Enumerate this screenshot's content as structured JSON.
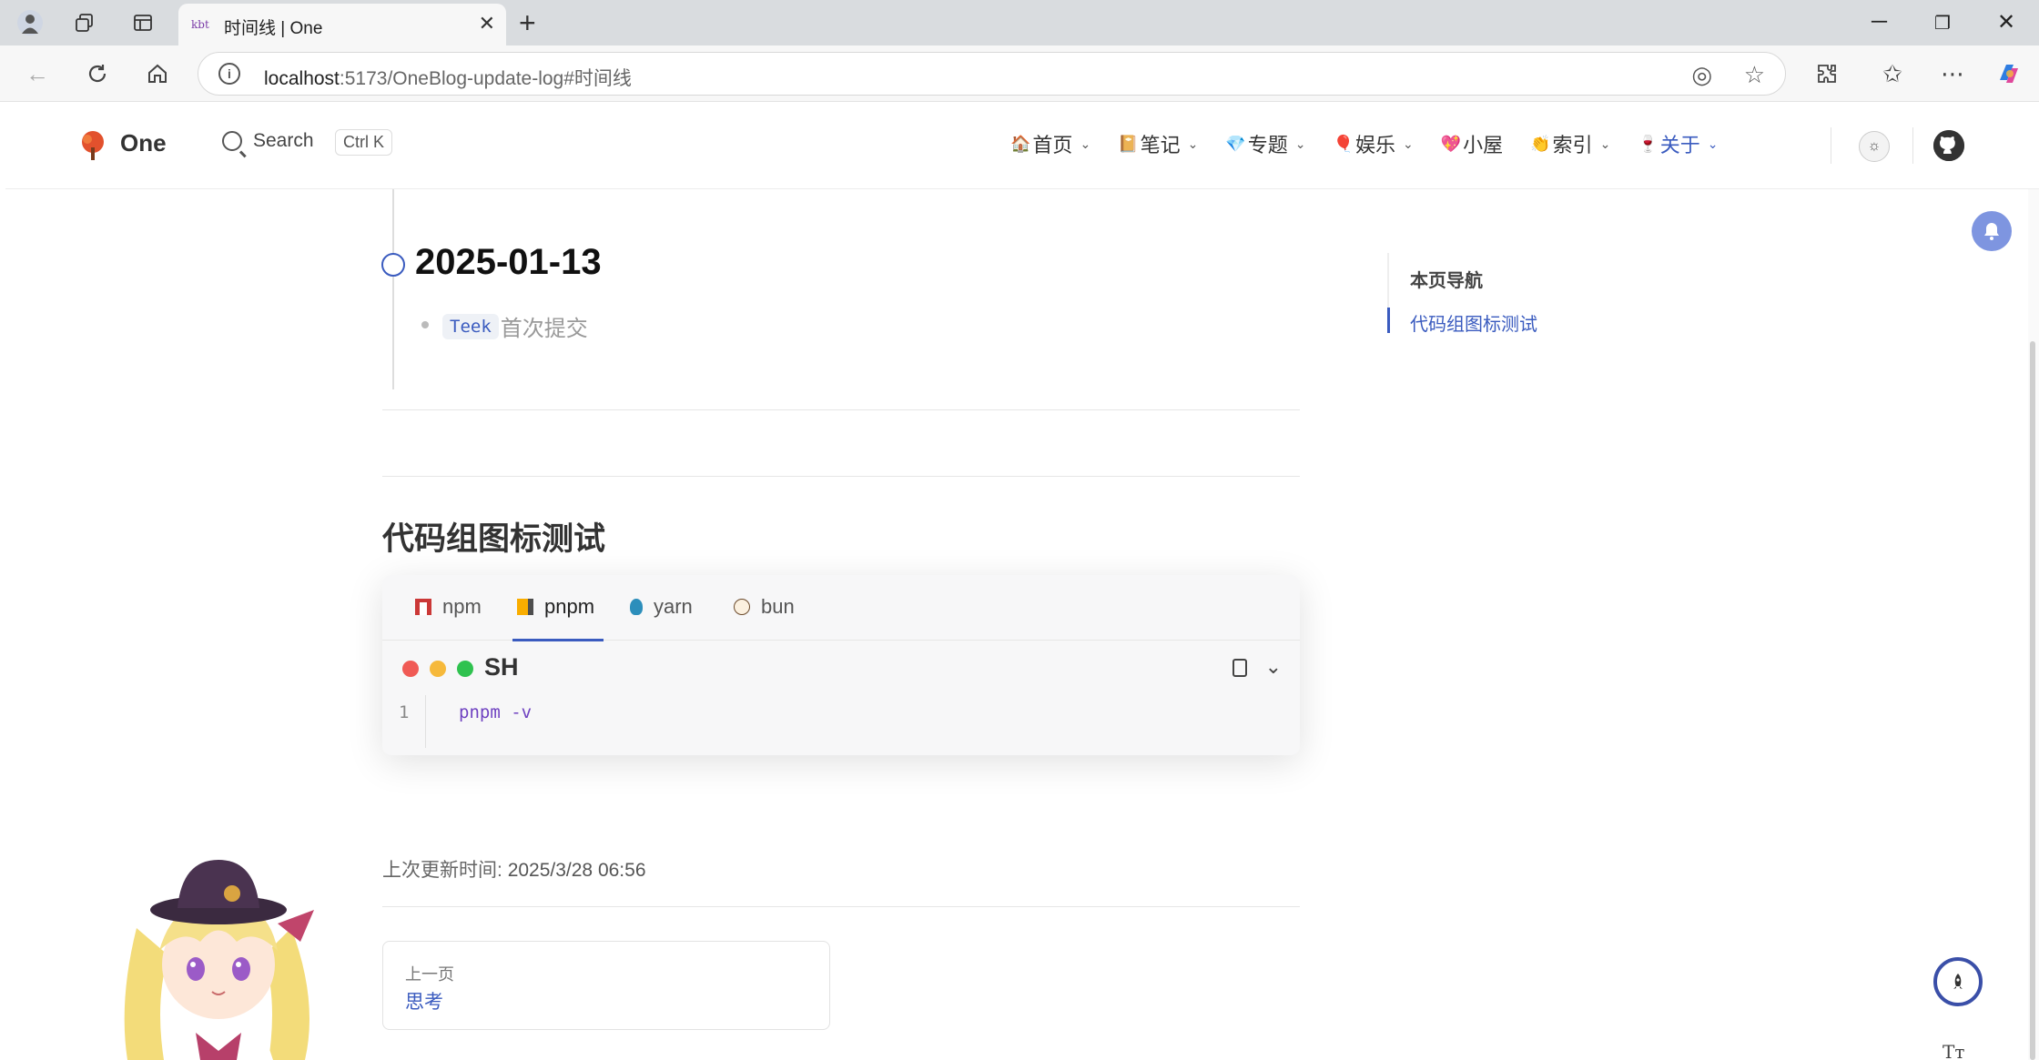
{
  "browser": {
    "tab_title": "时间线 | One",
    "favicon_text": "kbt",
    "url_host": "localhost",
    "url_rest": ":5173/OneBlog-update-log#时间线"
  },
  "header": {
    "site_name": "One",
    "search_label": "Search",
    "search_shortcut": "Ctrl K",
    "nav": [
      {
        "emoji": "🏠",
        "label": "首页",
        "has_dropdown": true
      },
      {
        "emoji": "📔",
        "label": "笔记",
        "has_dropdown": true
      },
      {
        "emoji": "💎",
        "label": "专题",
        "has_dropdown": true
      },
      {
        "emoji": "🎈",
        "label": "娱乐",
        "has_dropdown": true
      },
      {
        "emoji": "💖",
        "label": "小屋",
        "has_dropdown": false
      },
      {
        "emoji": "👏",
        "label": "索引",
        "has_dropdown": true
      },
      {
        "emoji": "🍷",
        "label": "关于",
        "has_dropdown": true
      }
    ]
  },
  "timeline": {
    "date": "2025-01-13",
    "item_code": "Teek",
    "item_text": "首次提交"
  },
  "section": {
    "title": "代码组图标测试"
  },
  "code_group": {
    "tabs": [
      "npm",
      "pnpm",
      "yarn",
      "bun"
    ],
    "active_tab": "pnpm",
    "language": "SH",
    "line_number": "1",
    "code": "pnpm -v"
  },
  "footer": {
    "last_updated_label": "上次更新时间:",
    "last_updated_value": "2025/3/28 06:56",
    "prev_label": "上一页",
    "prev_title": "思考"
  },
  "aside": {
    "title": "本页导航",
    "links": [
      "代码组图标测试"
    ]
  },
  "colors": {
    "brand": "#3a5bbf",
    "dot_red": "#f05a55",
    "dot_yellow": "#f6b93b",
    "dot_green": "#2fc24f"
  }
}
